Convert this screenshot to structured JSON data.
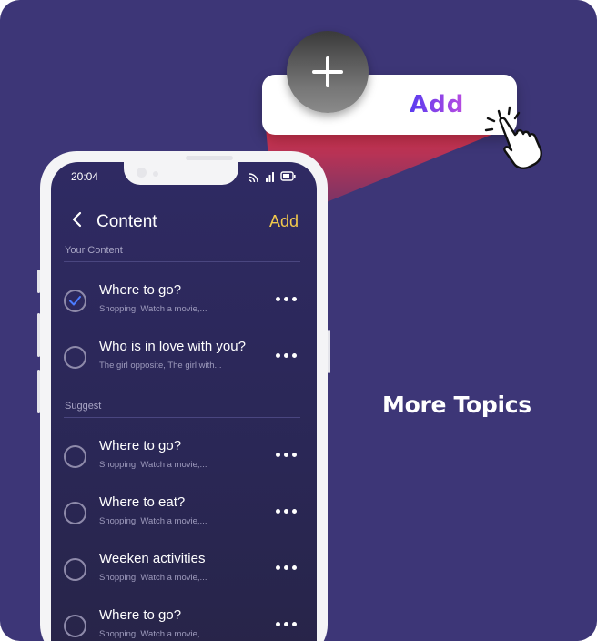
{
  "colors": {
    "background": "#3d3677",
    "accent": "#f2c94c",
    "check_active": "#4c7cff"
  },
  "callout": {
    "add_label": "Add",
    "plus_icon": "plus-icon",
    "pointer_icon": "hand-pointer-icon"
  },
  "promo": {
    "text": "More Topics"
  },
  "phone": {
    "status": {
      "time": "20:04",
      "icons": [
        "cast-icon",
        "signal-icon",
        "battery-icon"
      ]
    },
    "header": {
      "back_icon": "chevron-left-icon",
      "title": "Content",
      "add_label": "Add"
    },
    "sections": [
      {
        "label": "Your Content",
        "items": [
          {
            "title": "Where to go?",
            "subtitle": "Shopping, Watch a movie,...",
            "checked": true
          },
          {
            "title": "Who is in love with you?",
            "subtitle": "The girl opposite, The girl with...",
            "checked": false
          }
        ]
      },
      {
        "label": "Suggest",
        "items": [
          {
            "title": "Where to go?",
            "subtitle": "Shopping, Watch a movie,...",
            "checked": false
          },
          {
            "title": "Where to eat?",
            "subtitle": "Shopping, Watch a movie,...",
            "checked": false
          },
          {
            "title": "Weeken activities",
            "subtitle": "Shopping, Watch a movie,...",
            "checked": false
          },
          {
            "title": "Where to go?",
            "subtitle": "Shopping, Watch a movie,...",
            "checked": false
          }
        ]
      }
    ]
  }
}
